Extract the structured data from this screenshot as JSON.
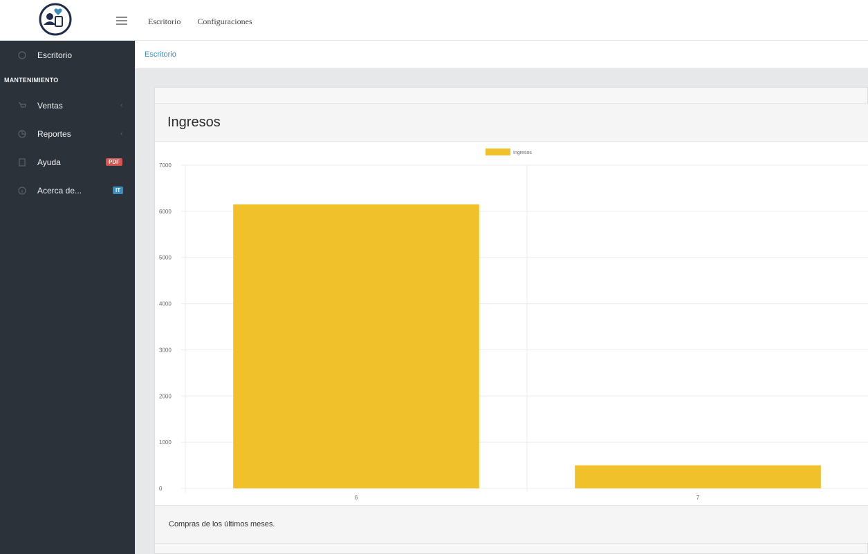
{
  "topbar": {
    "nav": [
      "Escritorio",
      "Configuraciones"
    ]
  },
  "sidebar": {
    "items": [
      {
        "label": "Escritorio",
        "icon": "dashboard-icon"
      },
      {
        "label": "Ventas",
        "icon": "cart-icon"
      },
      {
        "label": "Reportes",
        "icon": "chart-icon"
      },
      {
        "label": "Ayuda",
        "icon": "book-icon",
        "badge": "PDF"
      },
      {
        "label": "Acerca de...",
        "icon": "info-icon",
        "badge": "IT"
      }
    ],
    "section_header": "MANTENIMIENTO"
  },
  "breadcrumb": "Escritorio",
  "card": {
    "title": "Ingresos",
    "footer": "Compras de los últimos meses."
  },
  "colors": {
    "sidebar_bg": "#2b323a",
    "bar": "#f0c12b",
    "link": "#3c8dbc",
    "badge_pdf": "#d9534f",
    "badge_it": "#3c8dbc"
  },
  "chart_data": {
    "type": "bar",
    "categories": [
      "6",
      "7"
    ],
    "series": [
      {
        "name": "Ingresos",
        "values": [
          6150,
          500
        ]
      }
    ],
    "ylim": [
      0,
      7000
    ],
    "yticks": [
      0,
      1000,
      2000,
      3000,
      4000,
      5000,
      6000,
      7000
    ],
    "legend": "top-center",
    "grid": true
  }
}
